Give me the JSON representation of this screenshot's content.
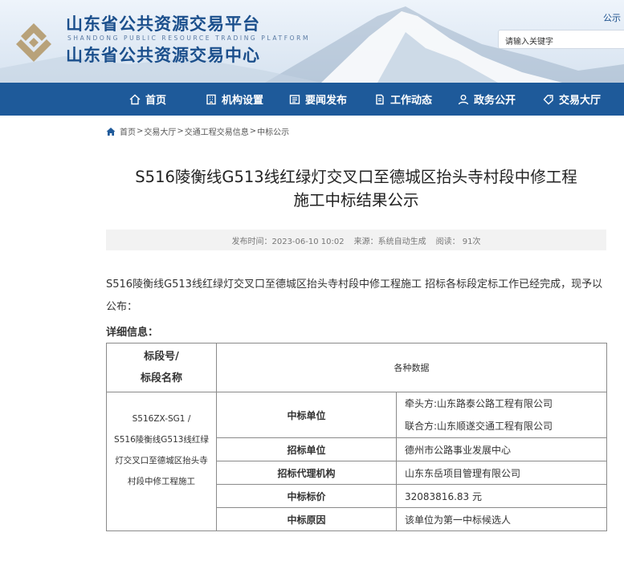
{
  "header": {
    "site_title_cn": "山东省公共资源交易平台",
    "site_title_en": "SHANDONG PUBLIC RESOURCE TRADING PLATFORM",
    "site_subtitle_cn": "山东省公共资源交易中心",
    "top_link": "公示",
    "search_placeholder": "请输入关键字"
  },
  "nav": {
    "items": [
      {
        "label": "首页",
        "icon": "home-icon"
      },
      {
        "label": "机构设置",
        "icon": "building-icon"
      },
      {
        "label": "要闻发布",
        "icon": "news-icon"
      },
      {
        "label": "工作动态",
        "icon": "document-icon"
      },
      {
        "label": "政务公开",
        "icon": "person-icon"
      },
      {
        "label": "交易大厅",
        "icon": "tag-icon"
      }
    ]
  },
  "breadcrumb": {
    "items": [
      "首页",
      "交易大厅",
      "交通工程交易信息",
      "中标公示"
    ],
    "separator": ">"
  },
  "article": {
    "title_line1": "S516陵衡线G513线红绿灯交叉口至德城区抬头寺村段中修工程",
    "title_line2": "施工中标结果公示",
    "meta": {
      "publish_time": "发布时间：2023-06-10 10:02",
      "source": "来源：系统自动生成",
      "views": "阅读： 91次"
    },
    "body": "S516陵衡线G513线红绿灯交叉口至德城区抬头寺村段中修工程施工 招标各标段定标工作已经完成，现予以公布：",
    "detail_label": "详细信息："
  },
  "table": {
    "header_col1_line1": "标段号/",
    "header_col1_line2": "标段名称",
    "header_col2": "各种数据",
    "lot_lines": [
      "S516ZX-SG1 /",
      "S516陵衡线G513线红绿",
      "灯交叉口至德城区抬头寺",
      "村段中修工程施工"
    ],
    "rows": {
      "winner_label": "中标单位",
      "winner_lead": "牵头方:山东路泰公路工程有限公司",
      "winner_partner": "联合方:山东顺遂交通工程有限公司",
      "tenderer_label": "招标单位",
      "tenderer_value": "德州市公路事业发展中心",
      "agency_label": "招标代理机构",
      "agency_value": "山东东岳项目管理有限公司",
      "price_label": "中标标价",
      "price_value": "32083816.83 元",
      "reason_label": "中标原因",
      "reason_value": "该单位为第一中标候选人"
    }
  },
  "colors": {
    "nav_bg": "#1e5a9a",
    "title_blue": "#1b4f8c",
    "logo_gold": "#b8a27a"
  }
}
